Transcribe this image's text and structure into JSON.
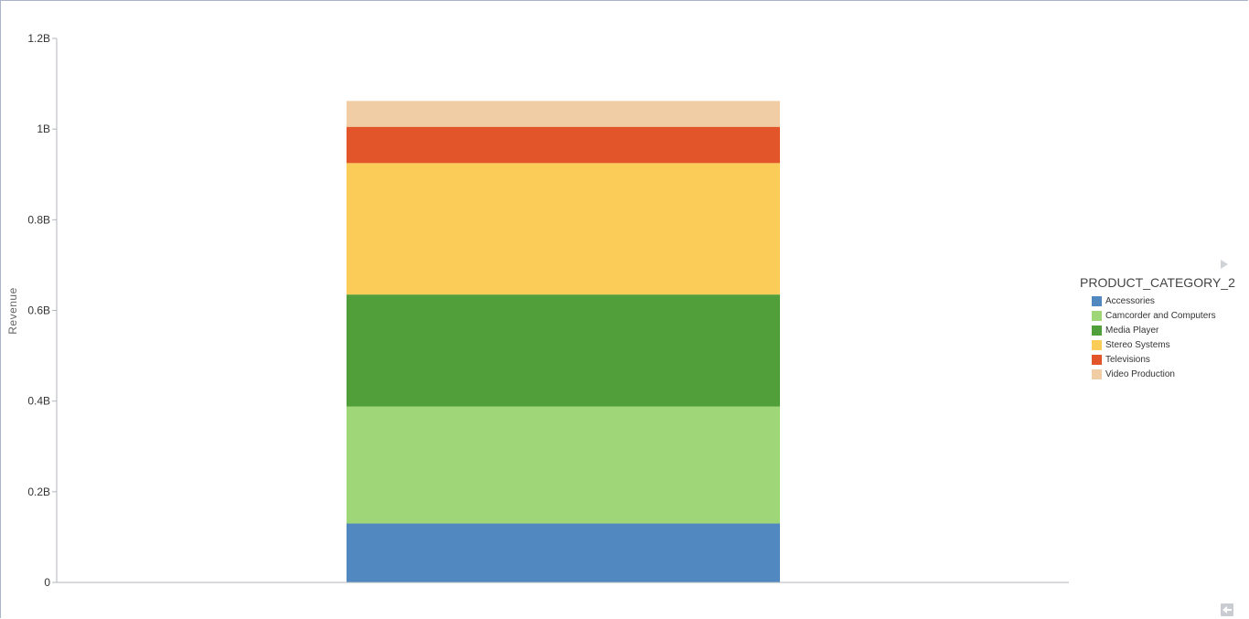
{
  "chart_data": {
    "type": "bar",
    "stacked": true,
    "categories": [
      ""
    ],
    "ylabel": "Revenue",
    "ylim": [
      0,
      1200000000
    ],
    "yticks": [
      {
        "value": 0,
        "label": "0"
      },
      {
        "value": 200000000,
        "label": "0.2B"
      },
      {
        "value": 400000000,
        "label": "0.4B"
      },
      {
        "value": 600000000,
        "label": "0.6B"
      },
      {
        "value": 800000000,
        "label": "0.8B"
      },
      {
        "value": 1000000000,
        "label": "1B"
      },
      {
        "value": 1200000000,
        "label": "1.2B"
      }
    ],
    "grid": false,
    "legend_position": "right",
    "legend_title": "PRODUCT_CATEGORY_2",
    "series": [
      {
        "name": "Accessories",
        "color": "#5188c0",
        "values": [
          130000000
        ]
      },
      {
        "name": "Camcorder and Computers",
        "color": "#9fd677",
        "values": [
          258000000
        ]
      },
      {
        "name": "Media Player",
        "color": "#509f3a",
        "values": [
          247000000
        ]
      },
      {
        "name": "Stereo Systems",
        "color": "#fbcc58",
        "values": [
          290000000
        ]
      },
      {
        "name": "Televisions",
        "color": "#e2552a",
        "values": [
          80000000
        ]
      },
      {
        "name": "Video Production",
        "color": "#f0cda4",
        "values": [
          57000000
        ]
      }
    ]
  }
}
